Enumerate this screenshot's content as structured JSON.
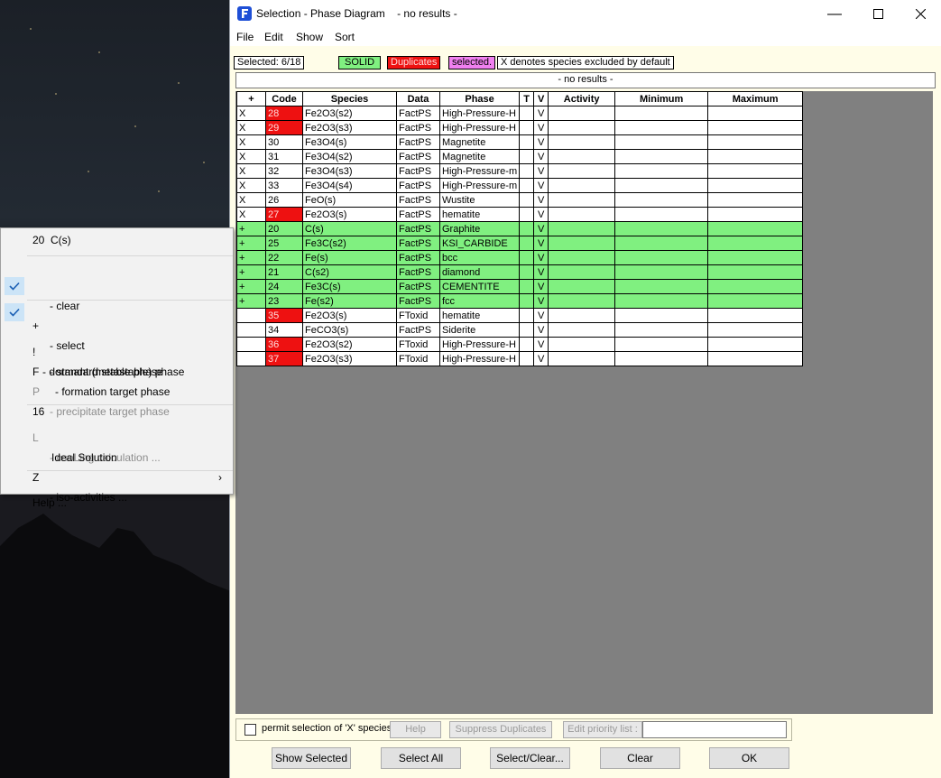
{
  "window": {
    "title": "Selection - Phase Diagram    - no results -",
    "controls": [
      "minimize",
      "maximize",
      "close"
    ]
  },
  "menu": [
    "File",
    "Edit",
    "Show",
    "Sort"
  ],
  "status": {
    "selected": "Selected: 6/18",
    "solid": "SOLID",
    "duplicates": "Duplicates",
    "selected_tag": "selected.",
    "x_note": "X denotes species excluded by default",
    "no_results": "- no results -"
  },
  "colors": {
    "solid": "#80f080",
    "duplicates": "#ee1111",
    "selected": "#f080f0",
    "selected_row": "#80f080",
    "grid_bg": "#808080",
    "window_bg": "#fffde8"
  },
  "table": {
    "headers": [
      "+",
      "Code",
      "Species",
      "Data",
      "Phase",
      "T",
      "V",
      "Activity",
      "Minimum",
      "Maximum"
    ],
    "rows": [
      {
        "mark": "X",
        "code": "28",
        "species": "Fe2O3(s2)",
        "data": "FactPS",
        "phase": "High-Pressure-H",
        "t": "",
        "v": "V",
        "dup": true,
        "sel": false
      },
      {
        "mark": "X",
        "code": "29",
        "species": "Fe2O3(s3)",
        "data": "FactPS",
        "phase": "High-Pressure-H",
        "t": "",
        "v": "V",
        "dup": true,
        "sel": false
      },
      {
        "mark": "X",
        "code": "30",
        "species": "Fe3O4(s)",
        "data": "FactPS",
        "phase": "Magnetite",
        "t": "",
        "v": "V",
        "dup": false,
        "sel": false
      },
      {
        "mark": "X",
        "code": "31",
        "species": "Fe3O4(s2)",
        "data": "FactPS",
        "phase": "Magnetite",
        "t": "",
        "v": "V",
        "dup": false,
        "sel": false
      },
      {
        "mark": "X",
        "code": "32",
        "species": "Fe3O4(s3)",
        "data": "FactPS",
        "phase": "High-Pressure-m",
        "t": "",
        "v": "V",
        "dup": false,
        "sel": false
      },
      {
        "mark": "X",
        "code": "33",
        "species": "Fe3O4(s4)",
        "data": "FactPS",
        "phase": "High-Pressure-m",
        "t": "",
        "v": "V",
        "dup": false,
        "sel": false
      },
      {
        "mark": "X",
        "code": "26",
        "species": "FeO(s)",
        "data": "FactPS",
        "phase": "Wustite",
        "t": "",
        "v": "V",
        "dup": false,
        "sel": false
      },
      {
        "mark": "X",
        "code": "27",
        "species": "Fe2O3(s)",
        "data": "FactPS",
        "phase": "hematite",
        "t": "",
        "v": "V",
        "dup": true,
        "sel": false
      },
      {
        "mark": "+",
        "code": "20",
        "species": "C(s)",
        "data": "FactPS",
        "phase": "Graphite",
        "t": "",
        "v": "V",
        "dup": false,
        "sel": true
      },
      {
        "mark": "+",
        "code": "25",
        "species": "Fe3C(s2)",
        "data": "FactPS",
        "phase": "KSI_CARBIDE",
        "t": "",
        "v": "V",
        "dup": false,
        "sel": true
      },
      {
        "mark": "+",
        "code": "22",
        "species": "Fe(s)",
        "data": "FactPS",
        "phase": "bcc",
        "t": "",
        "v": "V",
        "dup": false,
        "sel": true
      },
      {
        "mark": "+",
        "code": "21",
        "species": "C(s2)",
        "data": "FactPS",
        "phase": "diamond",
        "t": "",
        "v": "V",
        "dup": false,
        "sel": true
      },
      {
        "mark": "+",
        "code": "24",
        "species": "Fe3C(s)",
        "data": "FactPS",
        "phase": "CEMENTITE",
        "t": "",
        "v": "V",
        "dup": false,
        "sel": true
      },
      {
        "mark": "+",
        "code": "23",
        "species": "Fe(s2)",
        "data": "FactPS",
        "phase": "fcc",
        "t": "",
        "v": "V",
        "dup": false,
        "sel": true
      },
      {
        "mark": "",
        "code": "35",
        "species": "Fe2O3(s)",
        "data": "FToxid",
        "phase": "hematite",
        "t": "",
        "v": "V",
        "dup": true,
        "sel": false
      },
      {
        "mark": "",
        "code": "34",
        "species": "FeCO3(s)",
        "data": "FactPS",
        "phase": "Siderite",
        "t": "",
        "v": "V",
        "dup": false,
        "sel": false
      },
      {
        "mark": "",
        "code": "36",
        "species": "Fe2O3(s2)",
        "data": "FToxid",
        "phase": "High-Pressure-H",
        "t": "",
        "v": "V",
        "dup": true,
        "sel": false
      },
      {
        "mark": "",
        "code": "37",
        "species": "Fe2O3(s3)",
        "data": "FToxid",
        "phase": "High-Pressure-H",
        "t": "",
        "v": "V",
        "dup": true,
        "sel": false
      }
    ]
  },
  "bottom": {
    "permit": "permit selection of 'X' species",
    "help": "Help",
    "suppress": "Suppress Duplicates",
    "edit_priority": "Edit priority list :",
    "priority_value": "",
    "buttons": [
      "Show Selected",
      "Select All",
      "Select/Clear...",
      "Clear",
      "OK"
    ]
  },
  "context_menu": {
    "header": "20  C(s)",
    "clear": {
      "key": "",
      "text": "- clear"
    },
    "select": {
      "key": "+",
      "text": "- select",
      "checked": true
    },
    "standard": {
      "key": "",
      "text": "- standard stable phase",
      "checked": true
    },
    "dormant": {
      "key": "!",
      "text": "- dormant (metastable) phase"
    },
    "formation": {
      "key": "F",
      "text": "- formation target phase"
    },
    "precipitate": {
      "key": "P",
      "text": "- precipitate target phase"
    },
    "count": "16",
    "cooling": {
      "key": "L",
      "text": "- cooLing calculation ..."
    },
    "ideal": {
      "key": "",
      "text": "Ideal Solution"
    },
    "iso": {
      "key": "Z",
      "text": "- iso-activities ..."
    },
    "help": "Help ..."
  }
}
